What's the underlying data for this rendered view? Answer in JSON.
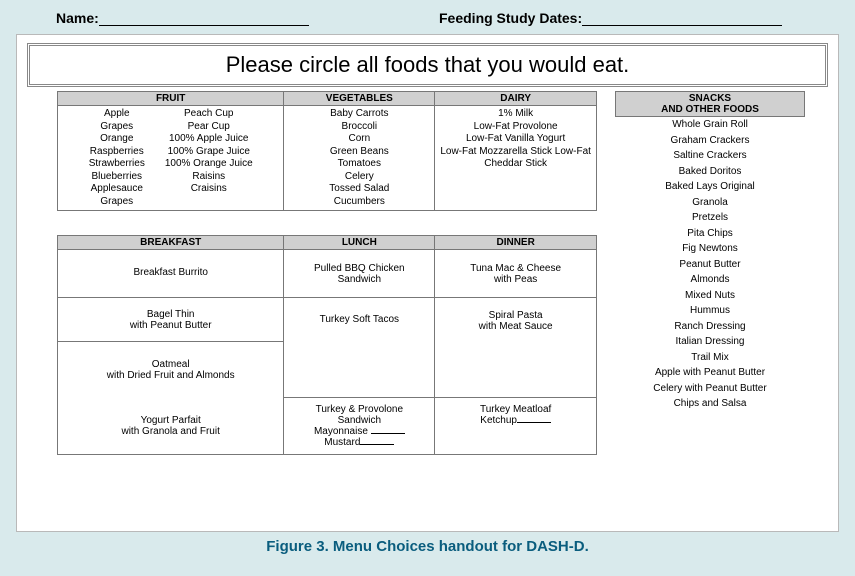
{
  "header": {
    "name_label": "Name:",
    "dates_label": "Feeding Study Dates:"
  },
  "instruction": "Please circle all foods that you would eat.",
  "categories": {
    "fruit": {
      "header": "FRUIT",
      "col1": [
        "Apple",
        "Grapes",
        "Orange",
        "Raspberries",
        "Strawberries",
        "Blueberries",
        "Applesauce",
        "Grapes"
      ],
      "col2": [
        "Peach Cup",
        "Pear Cup",
        "100% Apple Juice",
        "100% Grape Juice",
        "100% Orange Juice",
        "Raisins",
        "Craisins"
      ]
    },
    "vegetables": {
      "header": "VEGETABLES",
      "items": [
        "Baby Carrots",
        "Broccoli",
        "Corn",
        "Green Beans",
        "Tomatoes",
        "Celery",
        "Tossed Salad",
        "Cucumbers"
      ]
    },
    "dairy": {
      "header": "DAIRY",
      "items": [
        "1% Milk",
        "Low-Fat Provolone",
        "Low-Fat Vanilla Yogurt",
        "Low-Fat Mozzarella Stick Low-Fat",
        "Cheddar Stick"
      ]
    }
  },
  "snacks": {
    "header1": "SNACKS",
    "header2": "AND OTHER FOODS",
    "items": [
      "Whole Grain Roll",
      "Graham Crackers",
      "Saltine Crackers",
      "Baked Doritos",
      "Baked Lays Original",
      "Granola",
      "Pretzels",
      "Pita Chips",
      "Fig Newtons",
      "Peanut Butter",
      "Almonds",
      "Mixed Nuts",
      "Hummus",
      "Ranch Dressing",
      "Italian Dressing",
      "Trail Mix",
      "Apple with Peanut Butter",
      "Celery with Peanut Butter",
      "Chips and Salsa"
    ]
  },
  "meals": {
    "breakfast": {
      "header": "BREAKFAST",
      "r1": "Breakfast Burrito",
      "r2a": "Bagel Thin",
      "r2b": "with Peanut Butter",
      "r3a": "Oatmeal",
      "r3b": "with Dried Fruit and Almonds",
      "r4a": "Yogurt Parfait",
      "r4b": "with Granola and Fruit"
    },
    "lunch": {
      "header": "LUNCH",
      "r1a": "Pulled BBQ Chicken",
      "r1b": "Sandwich",
      "r2": "Turkey Soft Tacos",
      "r3a": "Turkey & Provolone",
      "r3b": "Sandwich",
      "r3c": "Mayonnaise",
      "r3d": "Mustard"
    },
    "dinner": {
      "header": "DINNER",
      "r1a": "Tuna Mac & Cheese",
      "r1b": "with Peas",
      "r2a": "Spiral Pasta",
      "r2b": "with Meat Sauce",
      "r3a": "Turkey Meatloaf",
      "r3b": "Ketchup"
    }
  },
  "caption": "Figure 3. Menu Choices handout for DASH-D."
}
